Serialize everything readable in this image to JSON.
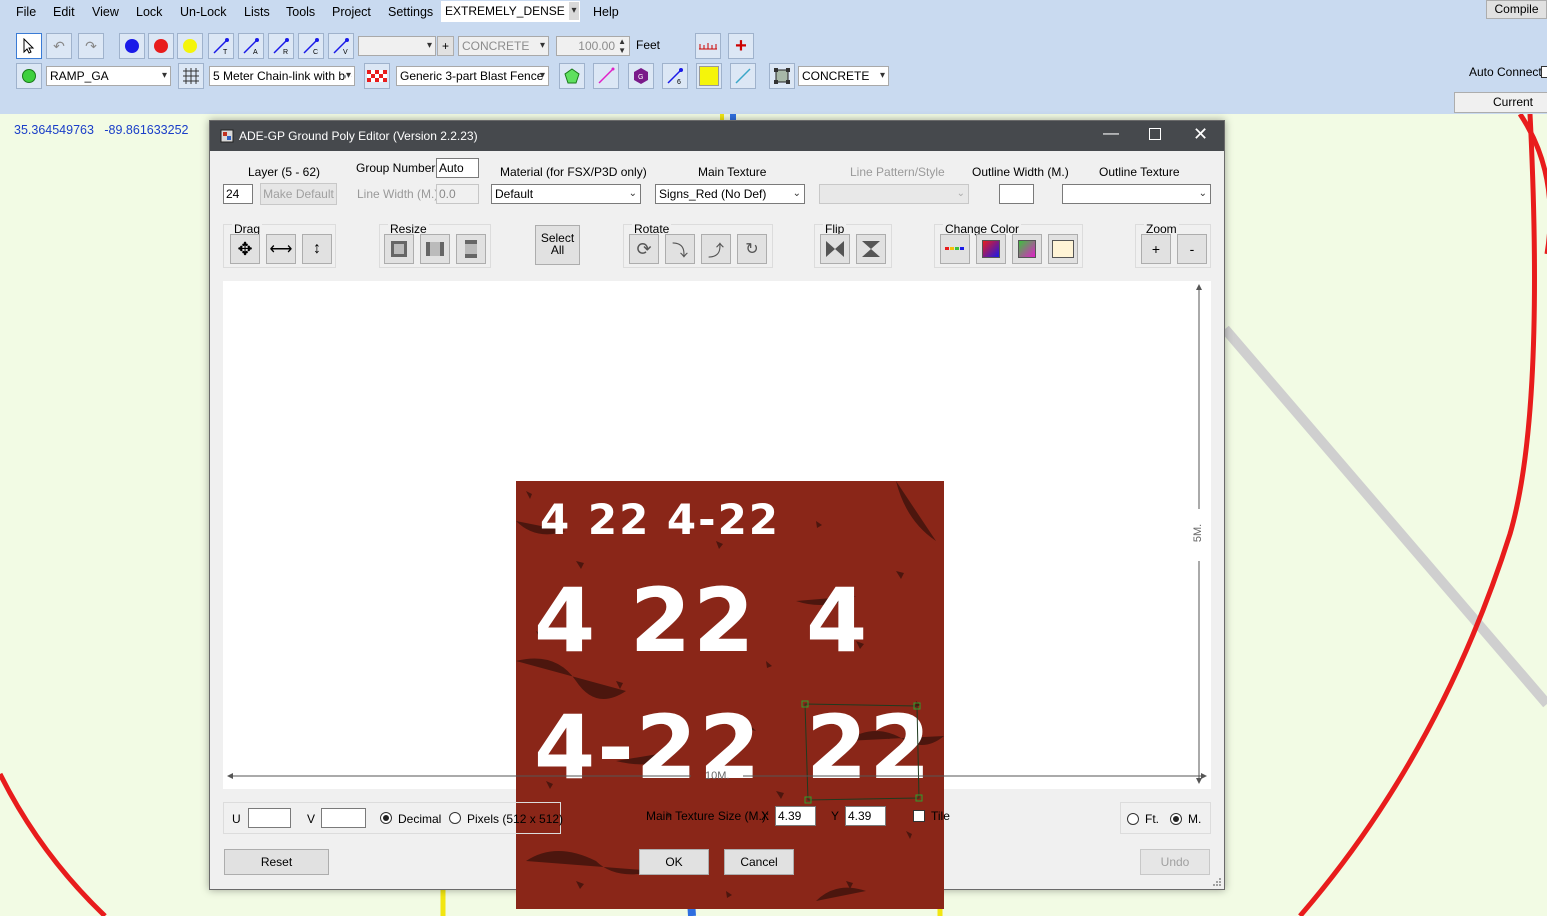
{
  "menubar": {
    "items": [
      "File",
      "Edit",
      "View",
      "Lock",
      "Un-Lock",
      "Lists",
      "Tools",
      "Project",
      "Settings"
    ],
    "density": "EXTREMELY_DENSE",
    "help": "Help",
    "compile": "Compile"
  },
  "toolbar": {
    "row1": {
      "material": "CONCRETE",
      "value": "100.00",
      "unit": "Feet",
      "plus": "+"
    },
    "row2": {
      "ramp": "RAMP_GA",
      "fence": "5 Meter Chain-link with be",
      "blast_fence": "Generic 3-part Blast Fence",
      "surface": "CONCRETE"
    },
    "auto_connect": "Auto Connect",
    "current": "Current"
  },
  "coords": {
    "lat": "35.364549763",
    "lon": "-89.861633252"
  },
  "dialog": {
    "title": "ADE-GP Ground Poly Editor (Version 2.2.23)",
    "layer_label": "Layer (5 - 62)",
    "layer_value": "24",
    "make_default": "Make Default",
    "group_number_label": "Group Number",
    "group_number_value": "Auto",
    "line_width_label": "Line Width (M.)",
    "line_width_value": "0.0",
    "material_label": "Material (for FSX/P3D only)",
    "material_value": "Default",
    "main_texture_label": "Main Texture",
    "main_texture_value": "Signs_Red (No Def)",
    "line_pattern_label": "Line Pattern/Style",
    "outline_width_label": "Outline Width (M.)",
    "outline_texture_label": "Outline Texture",
    "groups": {
      "drag": "Drag",
      "resize": "Resize",
      "select_all_1": "Select",
      "select_all_2": "All",
      "rotate": "Rotate",
      "flip": "Flip",
      "change_color": "Change Color",
      "zoom": "Zoom",
      "zoom_in": "+",
      "zoom_out": "-"
    },
    "canvas": {
      "height_label": "5M.",
      "width_label": "10M."
    },
    "texture_text": {
      "row1": "4 22 4-22",
      "row2a": "4 22",
      "row2b": "4",
      "row3a": "4-22",
      "row3b": "22"
    },
    "bottom": {
      "u_label": "U",
      "v_label": "V",
      "decimal": "Decimal",
      "pixels": "Pixels (512 x 512)",
      "size_label": "Main Texture Size (M.):",
      "x_label": "X",
      "x_value": "4.39",
      "y_label": "Y",
      "y_value": "4.39",
      "tile": "Tile",
      "ft": "Ft.",
      "m": "M.",
      "reset": "Reset",
      "ok": "OK",
      "cancel": "Cancel",
      "undo": "Undo"
    }
  },
  "colors": {
    "menubar_bg": "#c9daf0",
    "map_bg": "#f2fbe4",
    "titlebar_bg": "#46494d",
    "texture_bg": "#8a2618",
    "runway_red": "#e81c1c"
  }
}
